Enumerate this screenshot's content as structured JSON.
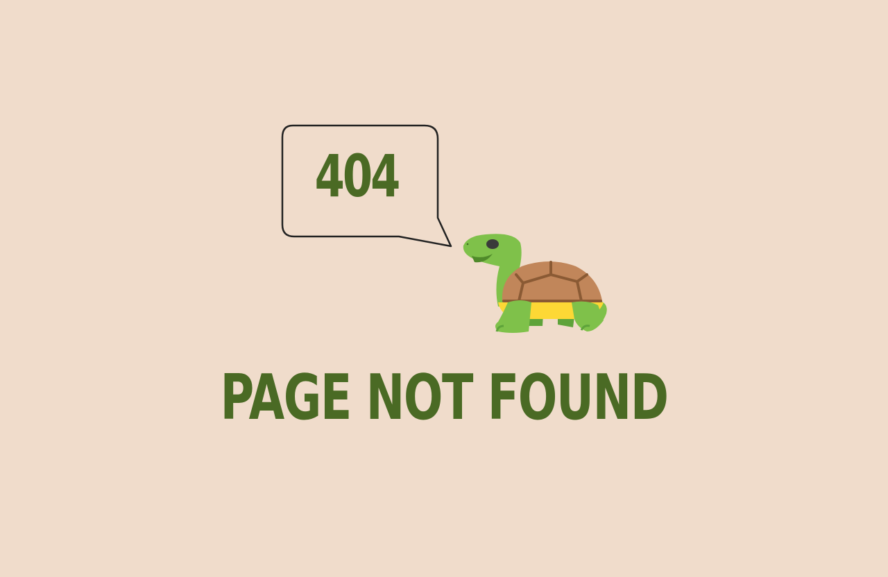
{
  "error": {
    "code": "404",
    "message": "PAGE NOT FOUND"
  },
  "colors": {
    "background": "#f0dccb",
    "text": "#4a6a24",
    "bubble_outline": "#222222",
    "turtle_skin": "#7fc14a",
    "shell": "#c1865a",
    "shell_lines": "#8a5a34",
    "belly": "#fdd835"
  },
  "icons": {
    "mascot": "turtle-icon",
    "bubble": "speech-bubble-icon"
  }
}
